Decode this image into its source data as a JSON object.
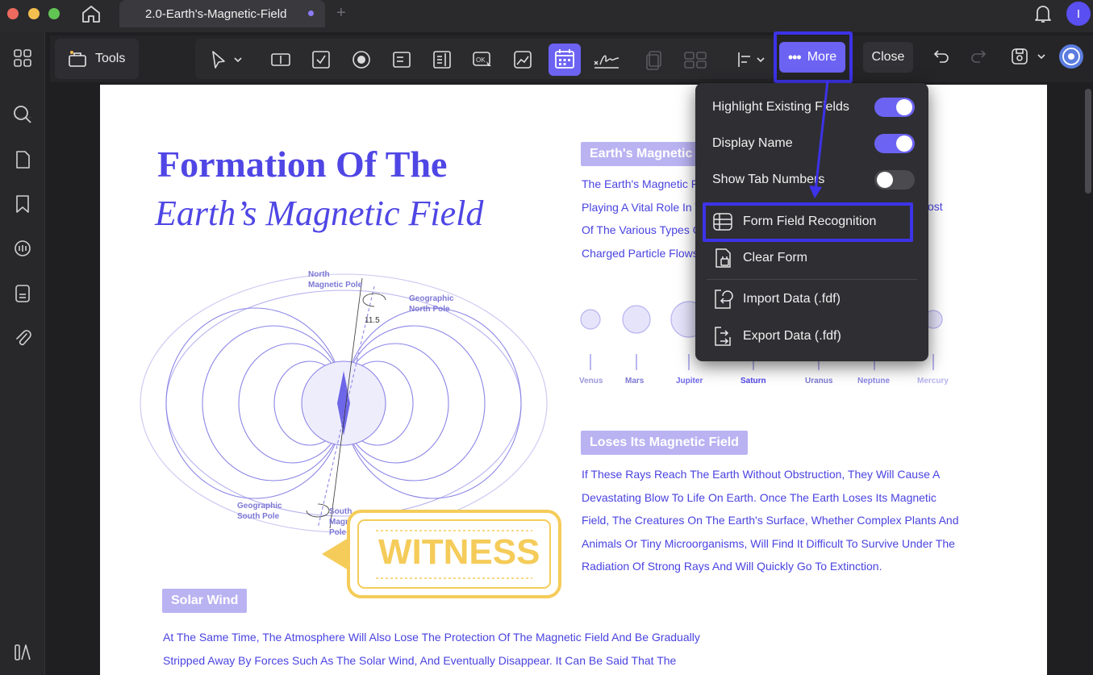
{
  "window": {
    "tab_title": "2.0-Earth's-Magnetic-Field"
  },
  "user": {
    "avatar_letter": "I"
  },
  "toolbar": {
    "tools_label": "Tools",
    "more_label": "More",
    "close_label": "Close"
  },
  "menu": {
    "toggles": [
      {
        "label": "Highlight Existing Fields",
        "on": true
      },
      {
        "label": "Display Name",
        "on": true
      },
      {
        "label": "Show Tab Numbers",
        "on": false
      }
    ],
    "items": [
      {
        "label": "Form Field Recognition",
        "icon": "form-field-recognition-icon"
      },
      {
        "label": "Clear Form",
        "icon": "clear-form-icon"
      },
      {
        "label": "Import Data (.fdf)",
        "icon": "import-data-icon"
      },
      {
        "label": "Export Data (.fdf)",
        "icon": "export-data-icon"
      }
    ]
  },
  "document": {
    "title_line1": "Formation Of The",
    "title_line2": "Earth’s Magnetic Field",
    "section1": {
      "heading": "Earth's Magnetic",
      "lines": [
        "The Earth's Magnetic Fi",
        "Playing A Vital Role In T",
        "Of The Various Types O",
        "Charged Particle Flows."
      ],
      "line2_tail": "ost"
    },
    "planets": [
      "Venus",
      "Mars",
      "Jupiter",
      "Saturn",
      "Uranus",
      "Neptune",
      "Mercury"
    ],
    "section2": {
      "heading": "Loses Its Magnetic Field",
      "lines": [
        "If These Rays Reach The Earth Without Obstruction, They Will Cause A",
        "Devastating Blow To Life On Earth. Once The Earth Loses Its Magnetic",
        "Field, The Creatures On The Earth's Surface, Whether Complex Plants And",
        "Animals Or Tiny Microorganisms, Will Find It Difficult To Survive Under The",
        "Radiation Of Strong Rays And Will Quickly Go To Extinction."
      ]
    },
    "section3": {
      "heading": "Solar Wind",
      "lines": [
        "At The Same Time, The Atmosphere Will Also Lose The Protection Of The Magnetic Field And Be Gradually",
        "Stripped Away By Forces Such As The Solar Wind, And Eventually Disappear. It Can Be Said That The"
      ]
    },
    "diagram": {
      "north_magnetic": [
        "North",
        "Magnetic Pole"
      ],
      "geo_north": [
        "Geographic",
        "North Pole"
      ],
      "geo_south": [
        "Geographic",
        "South Pole"
      ],
      "south_magnetic": [
        "South",
        "Magnetic",
        "Pole"
      ],
      "angle": "11.5"
    },
    "stamp": "WITNESS"
  },
  "colors": {
    "accent": "#6c63f3",
    "highlight_border": "#3d33e8",
    "doc_text": "#4a43e0",
    "stamp": "#f5cc5a"
  }
}
